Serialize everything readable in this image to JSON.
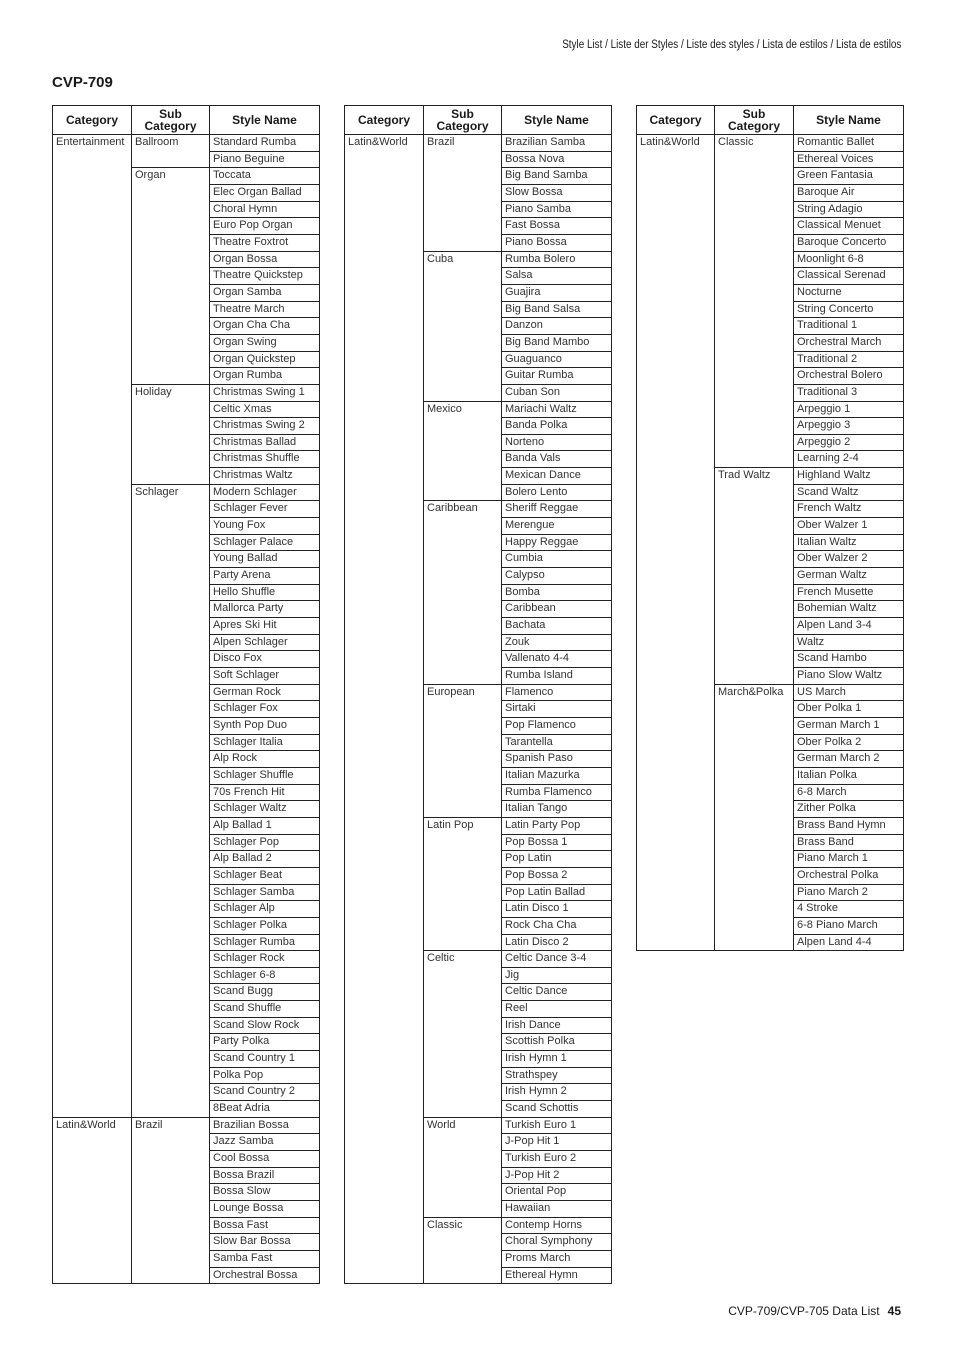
{
  "header": {
    "running_head": "Style List / Liste der Styles / Liste des styles / Lista de estilos / Lista de estilos"
  },
  "title": "CVP-709",
  "columns": {
    "category": "Category",
    "sub_category": "Sub Category",
    "style_name": "Style Name"
  },
  "tables": [
    {
      "groups": [
        {
          "category": "Entertainment",
          "sub": "Ballroom",
          "styles": [
            "Standard Rumba",
            "Piano Beguine"
          ]
        },
        {
          "category": "",
          "sub": "Organ",
          "styles": [
            "Toccata",
            "Elec Organ Ballad",
            "Choral Hymn",
            "Euro Pop Organ",
            "Theatre Foxtrot",
            "Organ Bossa",
            "Theatre Quickstep",
            "Organ Samba",
            "Theatre March",
            "Organ Cha Cha",
            "Organ Swing",
            "Organ Quickstep",
            "Organ Rumba"
          ]
        },
        {
          "category": "",
          "sub": "Holiday",
          "styles": [
            "Christmas Swing 1",
            "Celtic Xmas",
            "Christmas Swing 2",
            "Christmas Ballad",
            "Christmas Shuffle",
            "Christmas Waltz"
          ]
        },
        {
          "category": "",
          "sub": "Schlager",
          "styles": [
            "Modern Schlager",
            "Schlager Fever",
            "Young Fox",
            "Schlager Palace",
            "Young Ballad",
            "Party Arena",
            "Hello Shuffle",
            "Mallorca Party",
            "Apres Ski Hit",
            "Alpen Schlager",
            "Disco Fox",
            "Soft Schlager",
            "German Rock",
            "Schlager Fox",
            "Synth Pop Duo",
            "Schlager Italia",
            "Alp Rock",
            "Schlager Shuffle",
            "70s French Hit",
            "Schlager Waltz",
            "Alp Ballad 1",
            "Schlager Pop",
            "Alp Ballad 2",
            "Schlager Beat",
            "Schlager Samba",
            "Schlager Alp",
            "Schlager Polka",
            "Schlager Rumba",
            "Schlager Rock",
            "Schlager 6-8",
            "Scand Bugg",
            "Scand Shuffle",
            "Scand Slow Rock",
            "Party Polka",
            "Scand Country 1",
            "Polka Pop",
            "Scand Country 2",
            "8Beat Adria"
          ]
        },
        {
          "category": "Latin&World",
          "sub": "Brazil",
          "styles": [
            "Brazilian Bossa",
            "Jazz Samba",
            "Cool Bossa",
            "Bossa Brazil",
            "Bossa Slow",
            "Lounge Bossa",
            "Bossa Fast",
            "Slow Bar Bossa",
            "Samba Fast",
            "Orchestral Bossa"
          ]
        }
      ]
    },
    {
      "groups": [
        {
          "category": "Latin&World",
          "sub": "Brazil",
          "styles": [
            "Brazilian Samba",
            "Bossa Nova",
            "Big Band Samba",
            "Slow Bossa",
            "Piano Samba",
            "Fast Bossa",
            "Piano Bossa"
          ]
        },
        {
          "category": "",
          "sub": "Cuba",
          "styles": [
            "Rumba Bolero",
            "Salsa",
            "Guajira",
            "Big Band Salsa",
            "Danzon",
            "Big Band Mambo",
            "Guaguanco",
            "Guitar Rumba",
            "Cuban Son"
          ]
        },
        {
          "category": "",
          "sub": "Mexico",
          "styles": [
            "Mariachi Waltz",
            "Banda Polka",
            "Norteno",
            "Banda Vals",
            "Mexican Dance",
            "Bolero Lento"
          ]
        },
        {
          "category": "",
          "sub": "Caribbean",
          "styles": [
            "Sheriff Reggae",
            "Merengue",
            "Happy Reggae",
            "Cumbia",
            "Calypso",
            "Bomba",
            "Caribbean",
            "Bachata",
            "Zouk",
            "Vallenato 4-4",
            "Rumba Island"
          ]
        },
        {
          "category": "",
          "sub": "European",
          "styles": [
            "Flamenco",
            "Sirtaki",
            "Pop Flamenco",
            "Tarantella",
            "Spanish Paso",
            "Italian Mazurka",
            "Rumba Flamenco",
            "Italian Tango"
          ]
        },
        {
          "category": "",
          "sub": "Latin Pop",
          "styles": [
            "Latin Party Pop",
            "Pop Bossa 1",
            "Pop Latin",
            "Pop Bossa 2",
            "Pop Latin Ballad",
            "Latin Disco 1",
            "Rock Cha Cha",
            "Latin Disco 2"
          ]
        },
        {
          "category": "",
          "sub": "Celtic",
          "styles": [
            "Celtic Dance 3-4",
            "Jig",
            "Celtic Dance",
            "Reel",
            "Irish Dance",
            "Scottish Polka",
            "Irish Hymn 1",
            "Strathspey",
            "Irish Hymn 2",
            "Scand Schottis"
          ]
        },
        {
          "category": "",
          "sub": "World",
          "styles": [
            "Turkish Euro 1",
            "J-Pop Hit 1",
            "Turkish Euro 2",
            "J-Pop Hit 2",
            "Oriental Pop",
            "Hawaiian"
          ]
        },
        {
          "category": "",
          "sub": "Classic",
          "styles": [
            "Contemp Horns",
            "Choral Symphony",
            "Proms March",
            "Ethereal Hymn"
          ]
        }
      ]
    },
    {
      "groups": [
        {
          "category": "Latin&World",
          "sub": "Classic",
          "styles": [
            "Romantic Ballet",
            "Ethereal Voices",
            "Green Fantasia",
            "Baroque Air",
            "String Adagio",
            "Classical Menuet",
            "Baroque Concerto",
            "Moonlight 6-8",
            "Classical Serenad",
            "Nocturne",
            "String Concerto",
            "Traditional 1",
            "Orchestral March",
            "Traditional 2",
            "Orchestral Bolero",
            "Traditional 3",
            "Arpeggio 1",
            "Arpeggio 3",
            "Arpeggio 2",
            "Learning 2-4"
          ]
        },
        {
          "category": "",
          "sub": "Trad Waltz",
          "styles": [
            "Highland Waltz",
            "Scand Waltz",
            "French Waltz",
            "Ober Walzer 1",
            "Italian Waltz",
            "Ober Walzer 2",
            "German Waltz",
            "French Musette",
            "Bohemian Waltz",
            "Alpen Land 3-4",
            "Waltz",
            "Scand Hambo",
            "Piano Slow Waltz"
          ]
        },
        {
          "category": "",
          "sub": "March&Polka",
          "styles": [
            "US March",
            "Ober Polka 1",
            "German March 1",
            "Ober Polka 2",
            "German March 2",
            "Italian Polka",
            "6-8 March",
            "Zither Polka",
            "Brass Band Hymn",
            "Brass Band",
            "Piano March 1",
            "Orchestral Polka",
            "Piano March 2",
            "4 Stroke",
            "6-8 Piano March",
            "Alpen Land 4-4"
          ]
        }
      ]
    }
  ],
  "footer": {
    "doc_title": "CVP-709/CVP-705 Data List",
    "page_number": "45"
  }
}
